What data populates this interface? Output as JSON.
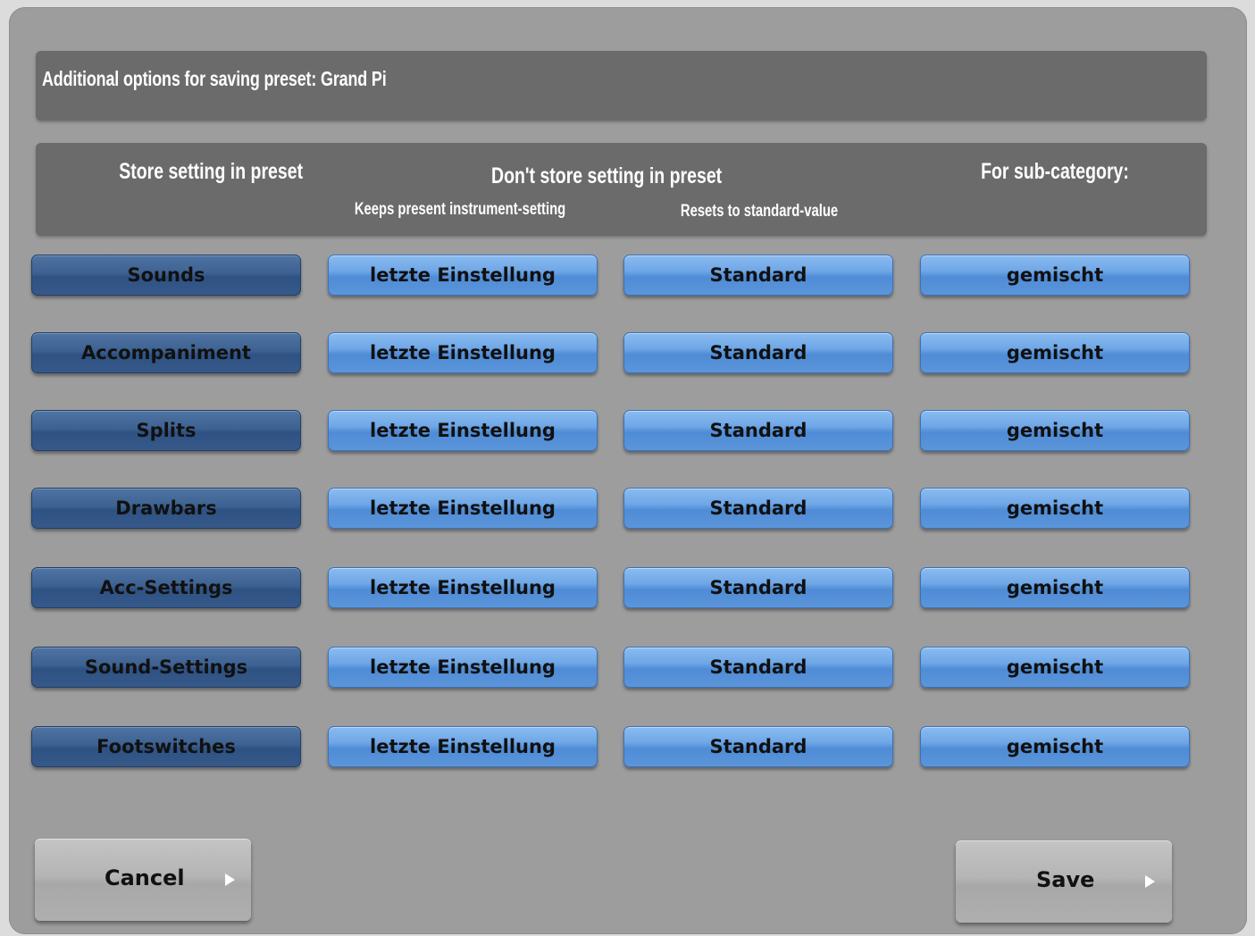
{
  "dialog": {
    "title": "Additional options for saving preset: Grand Pi"
  },
  "headers": {
    "store": "Store setting in preset",
    "dont_store": "Don't store setting in preset",
    "keeps_present": "Keeps present instrument-setting",
    "resets_standard": "Resets to standard-value",
    "sub_category": "For sub-category:"
  },
  "rows": [
    {
      "category": "Sounds",
      "keep": "letzte Einstellung",
      "reset": "Standard",
      "sub": "gemischt"
    },
    {
      "category": "Accompaniment",
      "keep": "letzte Einstellung",
      "reset": "Standard",
      "sub": "gemischt"
    },
    {
      "category": "Splits",
      "keep": "letzte Einstellung",
      "reset": "Standard",
      "sub": "gemischt"
    },
    {
      "category": "Drawbars",
      "keep": "letzte Einstellung",
      "reset": "Standard",
      "sub": "gemischt"
    },
    {
      "category": "Acc-Settings",
      "keep": "letzte Einstellung",
      "reset": "Standard",
      "sub": "gemischt"
    },
    {
      "category": "Sound-Settings",
      "keep": "letzte Einstellung",
      "reset": "Standard",
      "sub": "gemischt"
    },
    {
      "category": "Footswitches",
      "keep": "letzte Einstellung",
      "reset": "Standard",
      "sub": "gemischt"
    }
  ],
  "footer": {
    "cancel_label": "Cancel",
    "save_label": "Save"
  },
  "icons": {
    "cancel_arrow": "triangle-right",
    "save_arrow": "triangle-right"
  },
  "colors": {
    "panel": "#9d9d9d",
    "header_bar": "#6b6b6b",
    "dark_button": "#36598a",
    "light_button": "#5b95da"
  }
}
